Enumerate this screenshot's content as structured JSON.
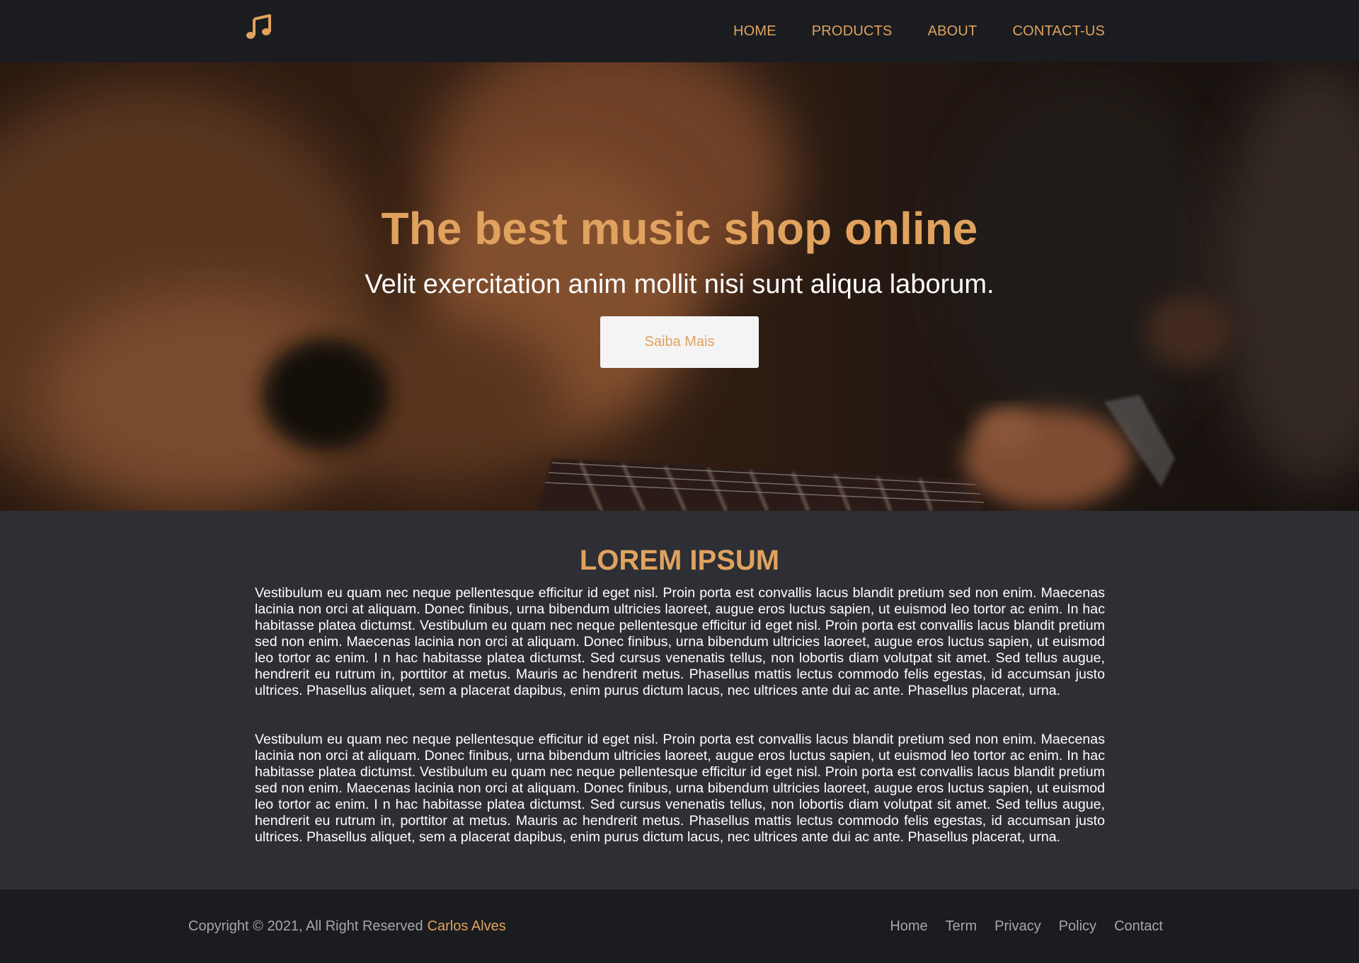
{
  "header": {
    "logo_icon": "music-note-icon",
    "nav": [
      {
        "label": "HOME"
      },
      {
        "label": "PRODUCTS"
      },
      {
        "label": "ABOUT"
      },
      {
        "label": "CONTACT-US"
      }
    ]
  },
  "hero": {
    "background_image": "guitar-photo",
    "title": "The best music shop online",
    "subtitle": "Velit exercitation anim mollit nisi sunt aliqua laborum.",
    "button_label": "Saiba Mais"
  },
  "content": {
    "title": "LOREM IPSUM",
    "paragraphs": [
      "Vestibulum eu quam nec neque pellentesque efficitur id eget nisl. Proin porta est convallis lacus blandit pretium sed non enim. Maecenas lacinia non orci at aliquam. Donec finibus, urna bibendum ultricies laoreet, augue eros luctus sapien, ut euismod leo tortor ac enim. In hac habitasse platea dictumst. Vestibulum eu quam nec neque pellentesque efficitur id eget nisl. Proin porta est convallis lacus blandit pretium sed non enim. Maecenas lacinia non orci at aliquam. Donec finibus, urna bibendum ultricies laoreet, augue eros luctus sapien, ut euismod leo tortor ac enim. I n hac habitasse platea dictumst. Sed cursus venenatis tellus, non lobortis diam volutpat sit amet. Sed tellus augue, hendrerit eu rutrum in, porttitor at metus. Mauris ac hendrerit metus. Phasellus mattis lectus commodo felis egestas, id accumsan justo ultrices. Phasellus aliquet, sem a placerat dapibus, enim purus dictum lacus, nec ultrices ante dui ac ante. Phasellus placerat, urna.",
      "Vestibulum eu quam nec neque pellentesque efficitur id eget nisl. Proin porta est convallis lacus blandit pretium sed non enim. Maecenas lacinia non orci at aliquam. Donec finibus, urna bibendum ultricies laoreet, augue eros luctus sapien, ut euismod leo tortor ac enim. In hac habitasse platea dictumst. Vestibulum eu quam nec neque pellentesque efficitur id eget nisl. Proin porta est convallis lacus blandit pretium sed non enim. Maecenas lacinia non orci at aliquam. Donec finibus, urna bibendum ultricies laoreet, augue eros luctus sapien, ut euismod leo tortor ac enim. I n hac habitasse platea dictumst. Sed cursus venenatis tellus, non lobortis diam volutpat sit amet. Sed tellus augue, hendrerit eu rutrum in, porttitor at metus. Mauris ac hendrerit metus. Phasellus mattis lectus commodo felis egestas, id accumsan justo ultrices. Phasellus aliquet, sem a placerat dapibus, enim purus dictum lacus, nec ultrices ante dui ac ante. Phasellus placerat, urna."
    ]
  },
  "footer": {
    "copyright_prefix": "Copyright © 2021, All Right Reserved",
    "owner": "Carlos Alves",
    "links": [
      {
        "label": "Home"
      },
      {
        "label": "Term"
      },
      {
        "label": "Privacy"
      },
      {
        "label": "Policy"
      },
      {
        "label": "Contact"
      }
    ]
  },
  "colors": {
    "accent": "#e0a25e",
    "header_bg": "#1b1c20",
    "content_bg": "#2d2f34",
    "muted_text": "#a6a6a6",
    "button_bg": "#f4f4f4"
  }
}
